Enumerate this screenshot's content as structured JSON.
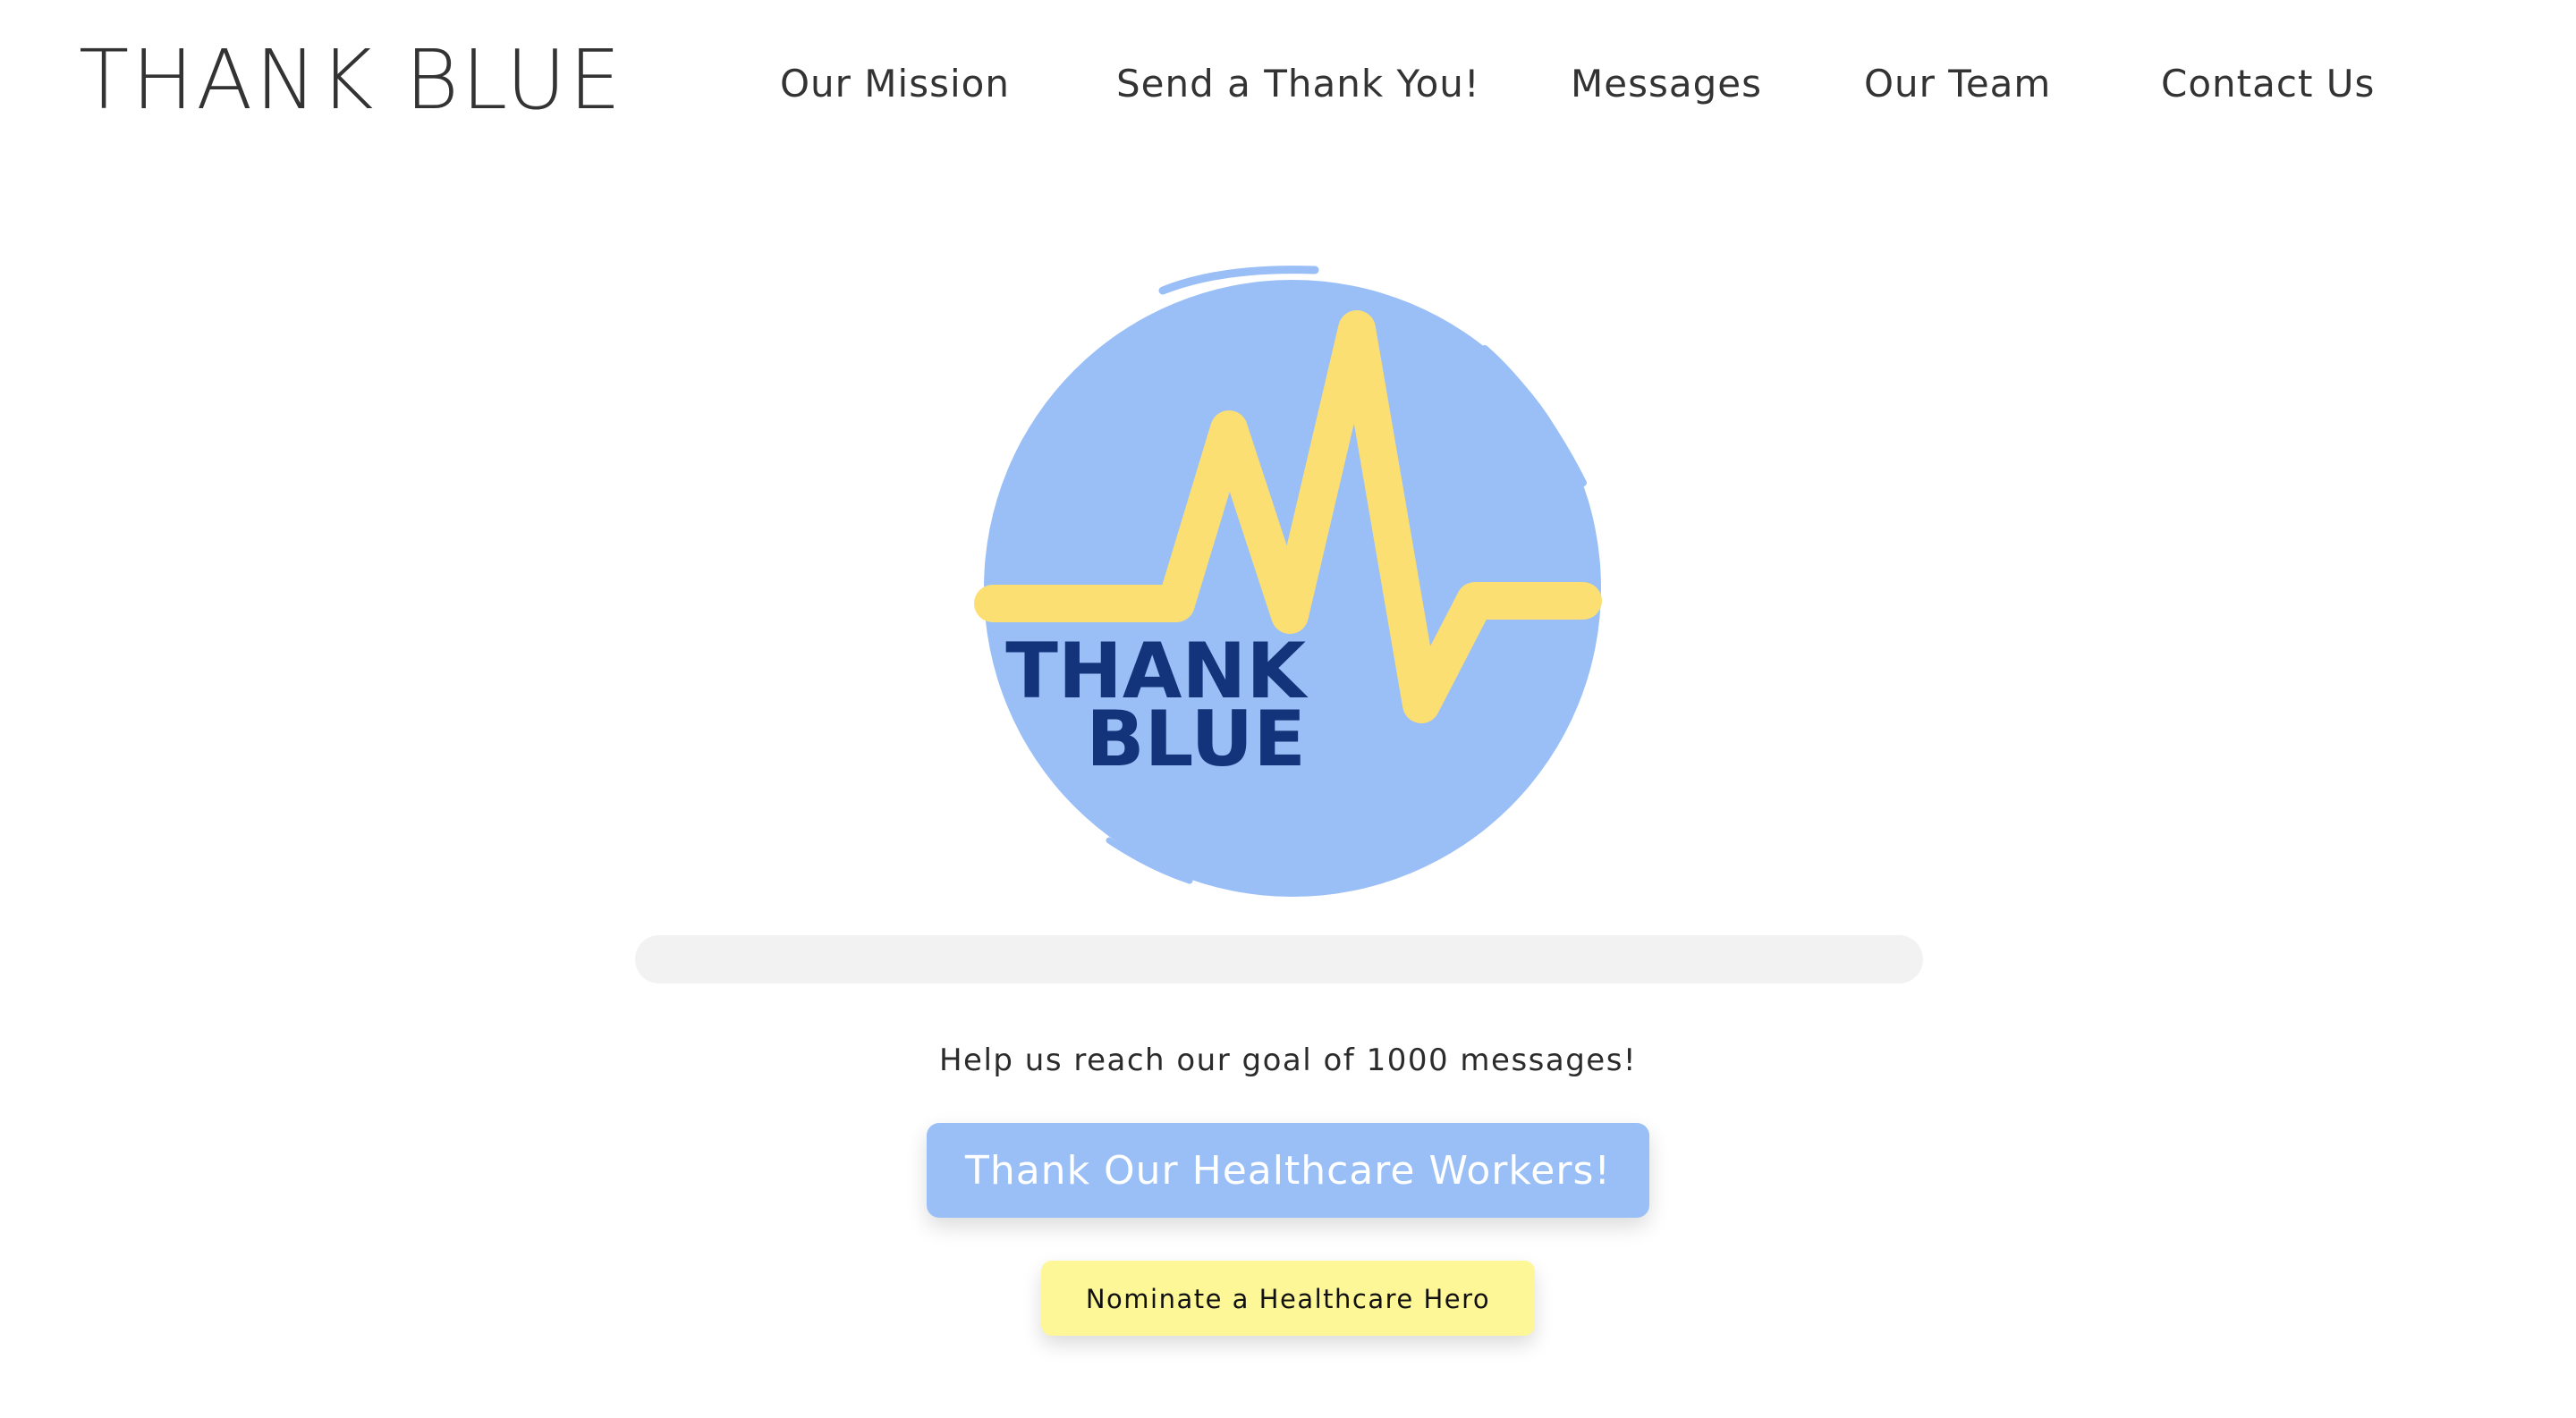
{
  "header": {
    "brand": "THANK BLUE",
    "nav": [
      {
        "label": "Our Mission"
      },
      {
        "label": "Send a Thank You!"
      },
      {
        "label": "Messages"
      },
      {
        "label": "Our Team"
      },
      {
        "label": "Contact Us"
      }
    ]
  },
  "hero": {
    "logo_line1": "THANK",
    "logo_line2": "BLUE",
    "progress_fraction": 0,
    "goal_text": "Help us reach our goal of 1000 messages!",
    "primary_cta": "Thank Our Healthcare Workers!",
    "secondary_cta": "Nominate a Healthcare Hero"
  },
  "colors": {
    "circle": "#9abff7",
    "pulse": "#fbdf73",
    "logo_text": "#13337a",
    "progress_track": "#f2f2f2",
    "progress_fill": "#9abff7",
    "primary_button": "#9abff7",
    "secondary_button": "#fdf797"
  }
}
